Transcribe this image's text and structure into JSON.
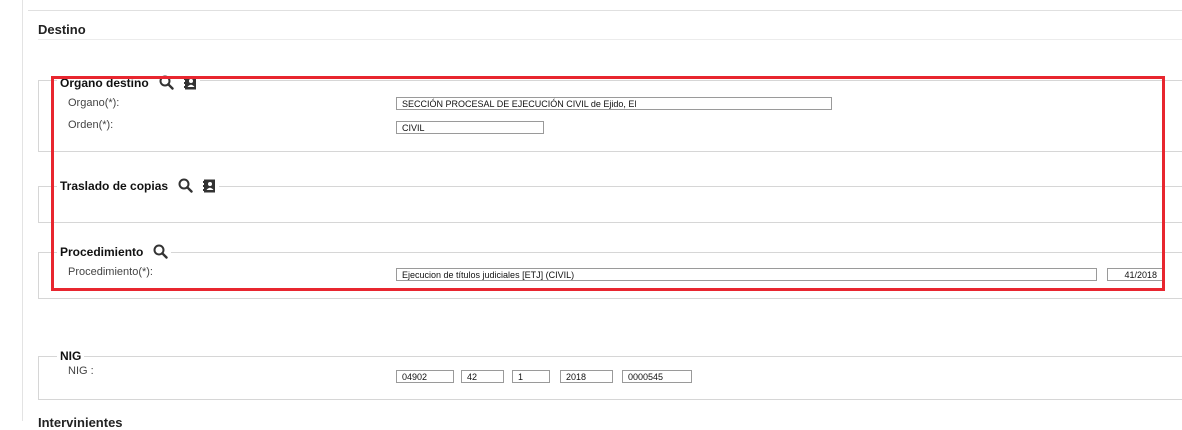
{
  "destino": {
    "title": "Destino"
  },
  "organo_destino": {
    "legend": "Organo destino",
    "organo_label": "Organo(*):",
    "organo_value": "SECCIÓN PROCESAL DE EJECUCIÓN CIVIL de Ejido, El",
    "orden_label": "Orden(*):",
    "orden_value": "CIVIL"
  },
  "traslado": {
    "legend": "Traslado de copias"
  },
  "procedimiento": {
    "legend": "Procedimiento",
    "label": "Procedimiento(*):",
    "value": "Ejecucion de títulos judiciales [ETJ] (CIVIL)",
    "number": "41/2018"
  },
  "nig": {
    "legend": "NIG",
    "label": "NIG :",
    "parts": [
      "04902",
      "42",
      "1",
      "2018",
      "0000545"
    ]
  },
  "intervinientes": {
    "title": "Intervinientes"
  },
  "icons": {
    "search": "search-icon",
    "address_book": "address-book-icon"
  },
  "colors": {
    "highlight": "#e8262f"
  }
}
